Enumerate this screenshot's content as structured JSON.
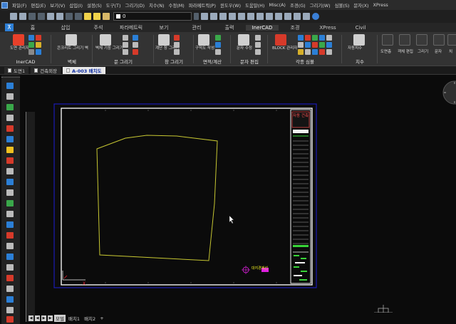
{
  "menu_items": [
    "파일(F)",
    "편집(E)",
    "보기(V)",
    "삽입(I)",
    "설정(S)",
    "도구(T)",
    "그리기(D)",
    "치수(N)",
    "수정(M)",
    "파라메트릭(P)",
    "윈도우(W)",
    "도움말(H)",
    "Misc(A)",
    "조경(G)",
    "그리기(W)",
    "심볼(S)",
    "문자(X)",
    "XPress"
  ],
  "layer_combo": {
    "value": "0"
  },
  "ribbon_tabs": [
    "홈",
    "삽입",
    "주석",
    "파라메트릭",
    "보기",
    "관리",
    "출력",
    "InerCAD",
    "조경",
    "XPress",
    "Civil"
  ],
  "active_tab": "InerCAD",
  "ribbon_groups": {
    "inercad": {
      "label": "InerCAD",
      "btn": "도면 관리자"
    },
    "wall": {
      "label": "벽체",
      "btn": "콘크리트 그리기 벽"
    },
    "column": {
      "label": "문 그리기",
      "btn": "벽체 기둥 그리기"
    },
    "stair": {
      "label": "창 그리기",
      "btn": "계단 창 그리기"
    },
    "area": {
      "label": "면적/계산",
      "btn": "구적도 작성"
    },
    "text": {
      "label": "문자 편집",
      "btn": "문자 수정"
    },
    "block": {
      "label": "각종 심볼",
      "btn": "BLOCK 관리자"
    },
    "dim": {
      "label": "치수",
      "btn": "자동치수"
    },
    "extra": {
      "labels": [
        "도면층",
        "객체 편집",
        "그리기",
        "문자",
        "치"
      ]
    }
  },
  "doc_tabs": [
    "도면1",
    "건축외장",
    "A-003 배치도"
  ],
  "active_doc": "A-003 배치도",
  "status_tabs": [
    "모델",
    "배치1",
    "배치2"
  ],
  "status_nav": [
    "◀",
    "◀",
    "▶",
    "▶"
  ],
  "status_add": "+",
  "drawing": {
    "title_label": "대지경계선",
    "titleblock_heading": "자동 건축",
    "colors": {
      "boundary": "#c8c832",
      "sheet": "#f2f2f2",
      "frame": "#1c1cb4",
      "magenta": "#e020e0",
      "green": "#38d438"
    }
  }
}
